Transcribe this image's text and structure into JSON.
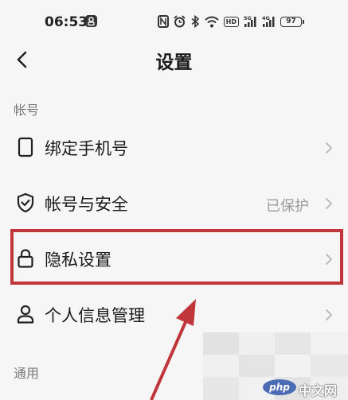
{
  "status_bar": {
    "time": "06:53",
    "battery": "97"
  },
  "nav": {
    "title": "设置"
  },
  "sections": {
    "account": "帐号",
    "general": "通用"
  },
  "rows": [
    {
      "label": "绑定手机号",
      "value": ""
    },
    {
      "label": "帐号与安全",
      "value": "已保护"
    },
    {
      "label": "隐私设置",
      "value": ""
    },
    {
      "label": "个人信息管理",
      "value": ""
    }
  ],
  "annotation": {
    "highlight_color": "#c0363a"
  },
  "watermark": {
    "logo": "php",
    "text": "中文网"
  }
}
